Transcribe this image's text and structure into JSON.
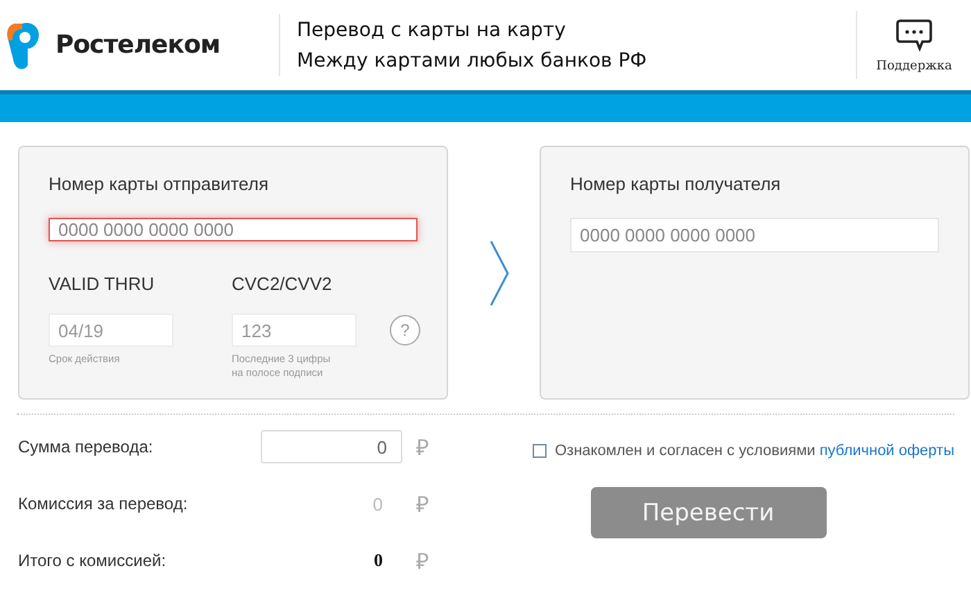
{
  "header": {
    "brand": "Ростелеком",
    "title": "Перевод с карты на карту",
    "subtitle": "Между картами любых банков РФ",
    "support": "Поддержка"
  },
  "sender": {
    "label": "Номер карты отправителя",
    "card": {
      "placeholder": "0000 0000 0000 0000",
      "error": true
    },
    "expiry": {
      "label": "VALID THRU",
      "placeholder": "04/19",
      "hint": "Срок действия"
    },
    "cvc": {
      "label": "CVC2/CVV2",
      "placeholder": "123",
      "hint": "Последние 3 цифры на полосе подписи",
      "help": "?"
    }
  },
  "recipient": {
    "label": "Номер карты получателя",
    "card": {
      "placeholder": "0000 0000 0000 0000",
      "error": false
    }
  },
  "summary": [
    {
      "kind": "input",
      "label": "Сумма перевода:",
      "value": "0",
      "currency": "₽"
    },
    {
      "kind": "muted",
      "label": "Комиссия за перевод:",
      "value": "0",
      "currency": "₽"
    },
    {
      "kind": "bold",
      "label": "Итого с комиссией:",
      "value": "0",
      "currency": "₽"
    }
  ],
  "agreement": {
    "checked": false,
    "text": "Ознакомлен и согласен с условиями",
    "link": "публичной оферты"
  },
  "submit": {
    "label": "Перевести",
    "disabled": true
  }
}
